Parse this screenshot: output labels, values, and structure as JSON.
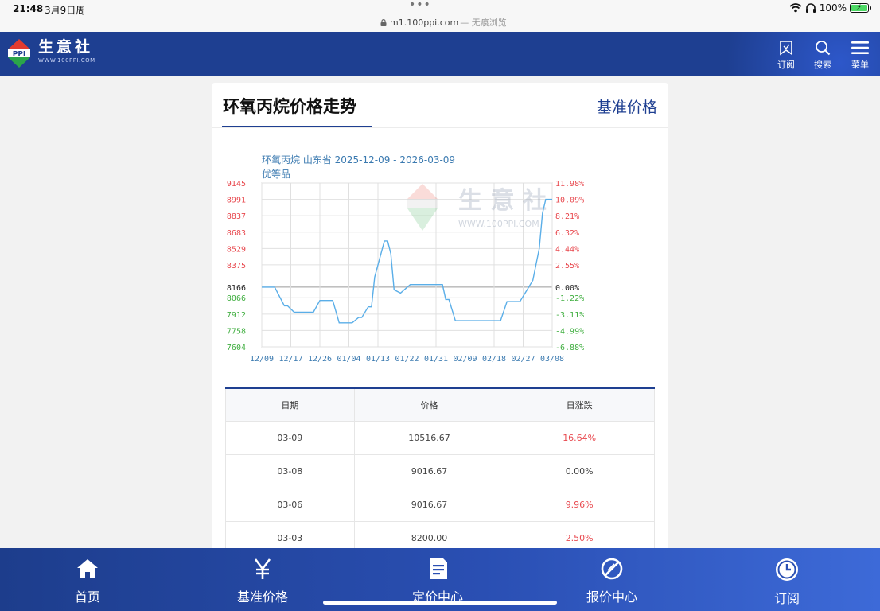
{
  "status_bar": {
    "time": "21:48",
    "date": "3月9日周一",
    "dots": "•••",
    "url": "m1.100ppi.com",
    "private_mode": "— 无痕浏览",
    "battery": "100%",
    "battery_level": 1.0
  },
  "header": {
    "brand_name": "生意社",
    "brand_url": "WWW.100PPI.COM",
    "logo_text": "PPI",
    "subscribe_label": "订阅",
    "search_label": "搜索",
    "menu_label": "菜单"
  },
  "page": {
    "title": "环氧丙烷价格走势",
    "benchmark_link": "基准价格"
  },
  "chart_data": {
    "type": "line",
    "title": "环氧丙烷 山东省 2025-12-09 - 2026-03-09",
    "subtitle": "优等品",
    "watermark": "生 意 社",
    "watermark_url": "WWW.100PPI.COM",
    "x_ticks": [
      "12/09",
      "12/17",
      "12/26",
      "01/04",
      "01/13",
      "01/22",
      "01/31",
      "02/09",
      "02/18",
      "02/27",
      "03/08"
    ],
    "y_ticks_left_up": [
      9145,
      8991,
      8837,
      8683,
      8529,
      8375
    ],
    "y_baseline": 8166,
    "y_ticks_left_down": [
      8066,
      7912,
      7758,
      7604
    ],
    "y_ticks_right_up": [
      "11.98%",
      "10.09%",
      "8.21%",
      "6.32%",
      "4.44%",
      "2.55%"
    ],
    "y_baseline_right": "0.00%",
    "y_ticks_right_down": [
      "-1.22%",
      "-3.11%",
      "-4.99%",
      "-6.88%"
    ],
    "ylim": [
      7604,
      9145
    ],
    "xlim_days": [
      0,
      90
    ],
    "series": [
      {
        "values_x": [
          0,
          4,
          7,
          8,
          10,
          16,
          18,
          22,
          24,
          28,
          30,
          31,
          33,
          34,
          35,
          38,
          39,
          40,
          41,
          43,
          46,
          48,
          49,
          50,
          52,
          53,
          56,
          57,
          58,
          60,
          74,
          76,
          80,
          82,
          84,
          86,
          87,
          88,
          89,
          90
        ],
        "values_y": [
          8166,
          8166,
          7990,
          7990,
          7930,
          7930,
          8040,
          8040,
          7830,
          7830,
          7880,
          7880,
          7980,
          7980,
          8260,
          8600,
          8600,
          8480,
          8140,
          8110,
          8190,
          8190,
          8190,
          8190,
          8190,
          8190,
          8190,
          8050,
          8050,
          7850,
          7850,
          8030,
          8030,
          8130,
          8230,
          8530,
          8860,
          8991,
          8991,
          8991
        ],
        "color": "#5aaee8"
      }
    ]
  },
  "table": {
    "headers": [
      "日期",
      "价格",
      "日涨跌"
    ],
    "rows": [
      {
        "date": "03-09",
        "price": "10516.67",
        "change": "16.64%",
        "dir": "up"
      },
      {
        "date": "03-08",
        "price": "9016.67",
        "change": "0.00%",
        "dir": "flat"
      },
      {
        "date": "03-06",
        "price": "9016.67",
        "change": "9.96%",
        "dir": "up"
      },
      {
        "date": "03-03",
        "price": "8200.00",
        "change": "2.50%",
        "dir": "up"
      }
    ]
  },
  "tabbar": {
    "items": [
      {
        "label": "首页",
        "icon": "home-icon"
      },
      {
        "label": "基准价格",
        "icon": "yen-icon"
      },
      {
        "label": "定价中心",
        "icon": "document-icon"
      },
      {
        "label": "报价中心",
        "icon": "ban-icon"
      },
      {
        "label": "订阅",
        "icon": "clock-icon"
      }
    ]
  },
  "colors": {
    "brand_blue": "#1e3f91",
    "up_red": "#e8484e",
    "down_green": "#3fae3f",
    "line_blue": "#5aaee8"
  }
}
